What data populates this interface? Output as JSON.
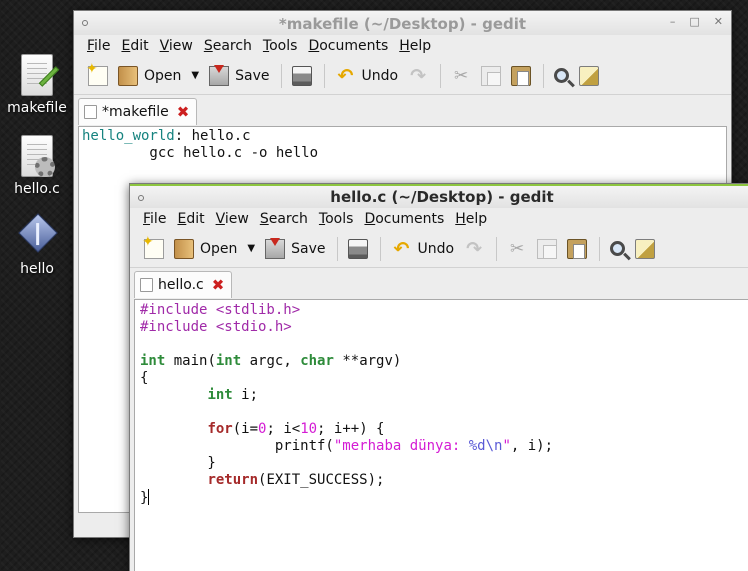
{
  "desktop": {
    "icons": [
      {
        "label": "makefile",
        "icon": "text-document-icon"
      },
      {
        "label": "hello.c",
        "icon": "source-file-icon"
      },
      {
        "label": "hello",
        "icon": "executable-icon"
      }
    ]
  },
  "windows": [
    {
      "title": "*makefile (~/Desktop) - gedit",
      "menu": [
        "File",
        "Edit",
        "View",
        "Search",
        "Tools",
        "Documents",
        "Help"
      ],
      "toolbar": {
        "open": "Open",
        "save": "Save",
        "undo": "Undo"
      },
      "tab": {
        "label": "*makefile",
        "close": "✖"
      },
      "lines": [
        [
          {
            "t": "hello_world",
            "c": "tgt"
          },
          {
            "t": ": hello.c"
          }
        ],
        [
          {
            "t": "\tgcc hello.c -o hello"
          }
        ]
      ]
    },
    {
      "title": "hello.c (~/Desktop) - gedit",
      "menu": [
        "File",
        "Edit",
        "View",
        "Search",
        "Tools",
        "Documents",
        "Help"
      ],
      "toolbar": {
        "open": "Open",
        "save": "Save",
        "undo": "Undo"
      },
      "tab": {
        "label": "hello.c",
        "close": "✖"
      },
      "lines": [
        [
          {
            "t": "#include <stdlib.h>",
            "c": "pre"
          }
        ],
        [
          {
            "t": "#include <stdio.h>",
            "c": "pre"
          }
        ],
        [],
        [
          {
            "t": "int",
            "c": "type"
          },
          {
            "t": " main("
          },
          {
            "t": "int",
            "c": "type"
          },
          {
            "t": " argc, "
          },
          {
            "t": "char",
            "c": "type"
          },
          {
            "t": " **argv)"
          }
        ],
        [
          {
            "t": "{"
          }
        ],
        [
          {
            "t": "\t"
          },
          {
            "t": "int",
            "c": "type"
          },
          {
            "t": " i;"
          }
        ],
        [],
        [
          {
            "t": "\t"
          },
          {
            "t": "for",
            "c": "kw"
          },
          {
            "t": "(i="
          },
          {
            "t": "0",
            "c": "num"
          },
          {
            "t": "; i<"
          },
          {
            "t": "10",
            "c": "num"
          },
          {
            "t": "; i++) {"
          }
        ],
        [
          {
            "t": "\t\tprintf("
          },
          {
            "t": "\"merhaba dünya: ",
            "c": "str"
          },
          {
            "t": "%d\\n",
            "c": "fmt"
          },
          {
            "t": "\"",
            "c": "str"
          },
          {
            "t": ", i);"
          }
        ],
        [
          {
            "t": "\t}"
          }
        ],
        [
          {
            "t": "\t"
          },
          {
            "t": "return",
            "c": "kw"
          },
          {
            "t": "(EXIT_SUCCESS);"
          }
        ],
        [
          {
            "t": "}"
          },
          {
            "cursor": true
          }
        ]
      ]
    }
  ],
  "colors": {
    "target": "#16837f",
    "preprocessor": "#a02aa8",
    "type": "#2e8b3a",
    "keyword": "#a52a2a",
    "number_string": "#d41cd4",
    "format": "#5a5ad6",
    "active_titlebar_accent": "#8dc63f",
    "tab_close": "#cc1f1f"
  }
}
